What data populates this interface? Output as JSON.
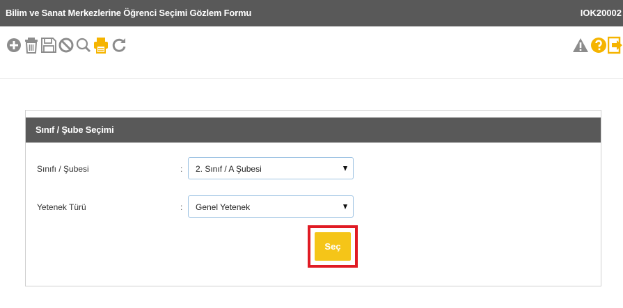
{
  "window": {
    "title": "Bilim ve Sanat Merkezlerine Öğrenci Seçimi Gözlem Formu",
    "form_code": "IOK20002"
  },
  "toolbar": {
    "left_icons": [
      "add-icon",
      "delete-icon",
      "save-icon",
      "cancel-icon",
      "search-icon",
      "print-icon",
      "refresh-icon"
    ],
    "right_icons": [
      "warning-icon",
      "help-icon",
      "exit-icon"
    ],
    "accent_color": "#f5b400",
    "icon_color": "#8c8c8c"
  },
  "panel": {
    "title": "Sınıf / Şube Seçimi",
    "rows": [
      {
        "label": "Sınıfı / Şubesi",
        "colon": ":",
        "selected": "2. Sınıf / A Şubesi"
      },
      {
        "label": "Yetenek Türü",
        "colon": ":",
        "selected": "Genel Yetenek"
      }
    ],
    "submit_label": "Seç",
    "highlight_color": "#e01b24",
    "button_color": "#f5c518"
  }
}
